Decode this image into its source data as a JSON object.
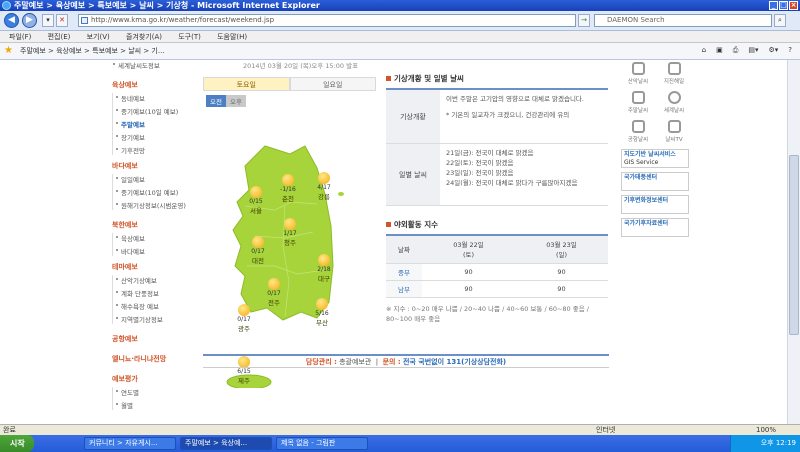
{
  "window": {
    "title": "주말예보 > 육상예보 > 특보예보 > 날씨 > 기상청 - Microsoft Internet Explorer"
  },
  "address": {
    "url": "http://www.kma.go.kr/weather/forecast/weekend.jsp",
    "search_placeholder": "DAEMON Search"
  },
  "menu": [
    "파일(F)",
    "편집(E)",
    "보기(V)",
    "즐겨찾기(A)",
    "도구(T)",
    "도움말(H)"
  ],
  "tab": {
    "label": "주말예보 > 육상예보 > 특보예보 > 날씨 > 기..."
  },
  "topinfo": "2014년 03월 20일 (목)오후 15:00 발표",
  "leftnav": [
    {
      "section": "",
      "items": [
        "세계날씨도정보"
      ]
    },
    {
      "section": "육상예보",
      "items": [
        "동네예보",
        "중기예보(10일 예보)",
        "주말예보",
        "장기예보",
        "기후전망"
      ]
    },
    {
      "section": "바다예보",
      "items": [
        "일일예보",
        "중기예보(10일 예보)",
        "원해기상정보(시범운영)"
      ]
    },
    {
      "section": "북한예보",
      "items": [
        "육상예보",
        "바다예보"
      ]
    },
    {
      "section": "테마예보",
      "items": [
        "산악기상예보",
        "계화 단풍정보",
        "해수욕장 예보",
        "지역별기상정보"
      ]
    },
    {
      "section": "공항예보",
      "items": []
    },
    {
      "section": "엘니뇨·라니냐전망",
      "items": []
    },
    {
      "section": "예보평가",
      "items": [
        "연도별",
        "월별"
      ]
    }
  ],
  "map": {
    "tabs": [
      "토요일",
      "일요일"
    ],
    "ampm": [
      "오전",
      "오후"
    ],
    "cities": [
      {
        "name": "서울",
        "temp": "0/15"
      },
      {
        "name": "춘천",
        "temp": "-1/16"
      },
      {
        "name": "강릉",
        "temp": "4/17"
      },
      {
        "name": "청주",
        "temp": "1/17"
      },
      {
        "name": "대전",
        "temp": "0/17"
      },
      {
        "name": "대구",
        "temp": "2/18"
      },
      {
        "name": "전주",
        "temp": "0/17"
      },
      {
        "name": "부산",
        "temp": "5/16"
      },
      {
        "name": "광주",
        "temp": "0/17"
      },
      {
        "name": "제주",
        "temp": "6/15"
      }
    ]
  },
  "weather": {
    "title": "기상개황 및 일별 날씨",
    "summary_label": "기상개황",
    "summary": [
      "이번 주말은 고기압의 영향으로 대체로 맑겠습니다.",
      "* 기온의 일교차가 크겠으니, 건강관리에 유의"
    ],
    "daily_label": "일별 날씨",
    "daily": [
      "21일(금): 전국이 대체로 맑겠음",
      "22일(토): 전국이 맑겠음",
      "23일(일): 전국이 맑겠음",
      "24일(월): 전국이 대체로 맑다가 구름많아지겠음"
    ]
  },
  "index": {
    "title": "야외활동 지수",
    "region_header": "날짜",
    "col1": "03월 22일\n(토)",
    "col2": "03월 23일\n(일)",
    "rows": [
      {
        "region": "중부",
        "v1": "90",
        "v2": "90"
      },
      {
        "region": "남부",
        "v1": "90",
        "v2": "90"
      }
    ],
    "note": "※ 지수 : 0~20 매우 나쁨 / 20~40 나쁨 / 40~60 보통 / 60~80 좋음 / 80~100 매우 좋음"
  },
  "rightcol": {
    "icons": [
      "산악날씨",
      "지진해일",
      "주말날씨",
      "세계날씨",
      "공항날씨",
      "날씨TV"
    ],
    "banners": [
      {
        "title": "지도기반 날씨서비스",
        "sub": "GIS Service"
      },
      {
        "title": "국가태풍센터",
        "sub": ""
      },
      {
        "title": "기후변화정보센터",
        "sub": ""
      },
      {
        "title": "국가기후자료센터",
        "sub": ""
      }
    ]
  },
  "footer": {
    "manager_label": "담당관리 :",
    "manager": "총괄예보관",
    "contact_label": "문의 :",
    "contact": "전국 국번없이 131(기상상담전화)"
  },
  "status": {
    "left": "완료",
    "zone": "인터넷",
    "zoom": "100%"
  },
  "taskbar": {
    "start": "시작",
    "tasks": [
      "커뮤니티 > 자유게시...",
      "주말예보 > 육상예...",
      "제목 없음 - 그림판"
    ],
    "clock": "오후 12:19"
  }
}
